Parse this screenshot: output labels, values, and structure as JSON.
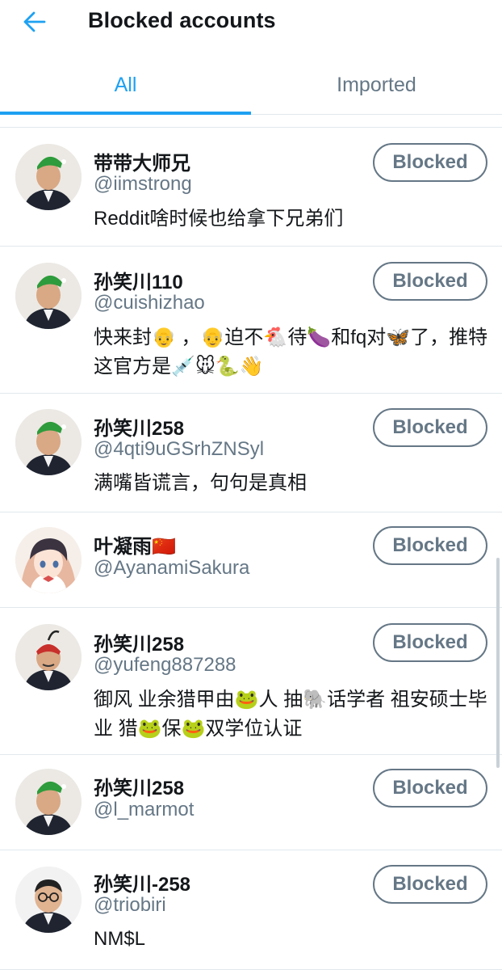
{
  "header": {
    "title": "Blocked accounts",
    "back_icon": "arrow-left-icon"
  },
  "tabs": [
    {
      "label": "All",
      "active": true
    },
    {
      "label": "Imported",
      "active": false
    }
  ],
  "colors": {
    "accent": "#1da1f2",
    "secondary_text": "#657786",
    "divider": "#e1e8ed"
  },
  "accounts": [
    {
      "name": "带带大师兄",
      "handle": "@iimstrong",
      "bio": "Reddit啥时候也给拿下兄弟们",
      "button": "Blocked",
      "avatar": "man-with-green-hat"
    },
    {
      "name": "孙笑川110",
      "handle": "@cuishizhao",
      "bio": "快来封👴 ，👴迫不🐔待🍆和fq对🦋了，推特这官方是💉🐭🐍👋",
      "button": "Blocked",
      "avatar": "man-with-green-hat"
    },
    {
      "name": "孙笑川258",
      "handle": "@4qti9uGSrhZNSyl",
      "bio": "满嘴皆谎言，句句是真相",
      "button": "Blocked",
      "avatar": "man-with-green-hat"
    },
    {
      "name": "叶凝雨🇨🇳",
      "handle": "@AyanamiSakura",
      "bio": "",
      "button": "Blocked",
      "avatar": "anime-girl"
    },
    {
      "name": "孙笑川258",
      "handle": "@yufeng887288",
      "bio": "御风 业余猎甲由🐸人 抽🐘话学者 祖安硕士毕业 猎🐸保🐸双学位认证",
      "button": "Blocked",
      "avatar": "man-with-red-hat"
    },
    {
      "name": "孙笑川258",
      "handle": "@l_marmot",
      "bio": "",
      "button": "Blocked",
      "avatar": "man-with-green-hat"
    },
    {
      "name": "孙笑川-258",
      "handle": "@triobiri",
      "bio": "NM$L",
      "button": "Blocked",
      "avatar": "man-with-glasses"
    }
  ]
}
